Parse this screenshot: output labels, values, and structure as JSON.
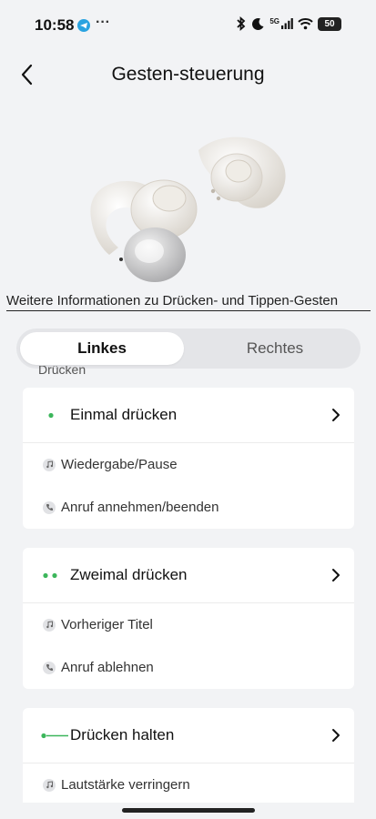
{
  "status": {
    "time": "10:58",
    "dots": "···",
    "network": "5G",
    "battery": "50"
  },
  "header": {
    "title": "Gesten-steuerung"
  },
  "info_link": "Weitere Informationen zu Drücken- und Tippen-Gesten",
  "tabs": [
    {
      "label": "Linkes",
      "active": true
    },
    {
      "label": "Rechtes",
      "active": false
    }
  ],
  "section_label": "Drücken",
  "cards": [
    {
      "title": "Einmal drücken",
      "indicator": "single-dot",
      "actions": [
        {
          "icon": "music-note-icon",
          "label": "Wiedergabe/Pause"
        },
        {
          "icon": "phone-icon",
          "label": "Anruf annehmen/beenden"
        }
      ]
    },
    {
      "title": "Zweimal drücken",
      "indicator": "double-dot",
      "actions": [
        {
          "icon": "music-note-icon",
          "label": "Vorheriger Titel"
        },
        {
          "icon": "phone-icon",
          "label": "Anruf ablehnen"
        }
      ]
    },
    {
      "title": "Drücken halten",
      "indicator": "dot-line",
      "actions": [
        {
          "icon": "music-note-icon",
          "label": "Lautstärke verringern"
        }
      ]
    }
  ],
  "colors": {
    "accent_green": "#3cb65b",
    "background": "#f2f3f5",
    "card": "#ffffff"
  }
}
